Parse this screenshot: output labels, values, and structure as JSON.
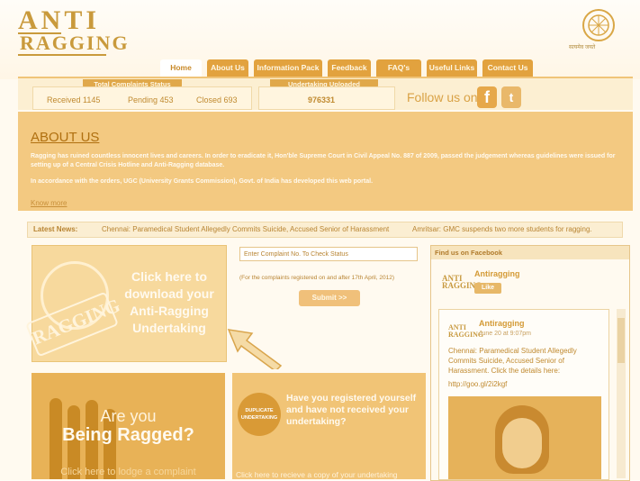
{
  "header": {
    "logo_line1": "ANTI",
    "logo_line2": "RAGGING",
    "emblem_caption": "सत्यमेव जयते"
  },
  "nav": {
    "tabs": [
      "Home",
      "About Us",
      "Information Pack",
      "Feedback",
      "FAQ's",
      "Useful Links",
      "Contact Us"
    ],
    "active": "Home"
  },
  "status": {
    "complaints_title": "Total Complaints Status",
    "received": "Received 1145",
    "pending": "Pending 453",
    "closed": "Closed 693",
    "undertaking_title": "Undertaking Uploaded",
    "undertaking_count": "976331",
    "follow_label": "Follow us on",
    "social": [
      "facebook-icon",
      "twitter-icon"
    ]
  },
  "about": {
    "title": "ABOUT US",
    "para1": "Ragging has ruined countless innocent lives and careers. In order to eradicate it, Hon'ble Supreme Court in Civil Appeal No. 887 of 2009, passed the judgement whereas guidelines were issued for setting up of a Central Crisis Hotline and Anti-Ragging database.",
    "para2": "In accordance with the orders, UGC (University Grants Commission), Govt. of India has developed this web portal.",
    "more": "Know more"
  },
  "news": {
    "label": "Latest News:",
    "items": [
      "Chennai: Paramedical Student Allegedly Commits Suicide, Accused Senior of Harassment",
      "Amritsar: GMC suspends two more students for ragging."
    ]
  },
  "download": {
    "stamp": "RAGGING",
    "text": "Click here to download your Anti-Ragging Undertaking"
  },
  "complaint": {
    "placeholder": "Enter Complaint No. To Check Status",
    "note": "(For the complaints registered on and after 17th April, 2012)",
    "submit": "Submit >>"
  },
  "facebook": {
    "title": "Find us on Facebook",
    "page_name": "Antiragging",
    "like": "Like",
    "post_name": "Antiragging",
    "post_date": "June 20 at 9:07pm",
    "post_text": "Chennai: Paramedical Student Allegedly Commits Suicide, Accused Senior of Harassment. Click the details here:",
    "post_link": "http://goo.gl/2i2kgf"
  },
  "ragged": {
    "line1": "Are you",
    "line2": "Being Ragged?",
    "line3": "Click here to lodge a complaint"
  },
  "duplicate": {
    "badge": "DUPLICATE UNDERTAKING",
    "question": "Have you registered yourself and have not received your undertaking?",
    "link": "Click here to recieve a copy of your undertaking"
  },
  "colors": {
    "accent": "#e2a23e",
    "background": "#fffaf0",
    "text": "#8a6a20"
  }
}
